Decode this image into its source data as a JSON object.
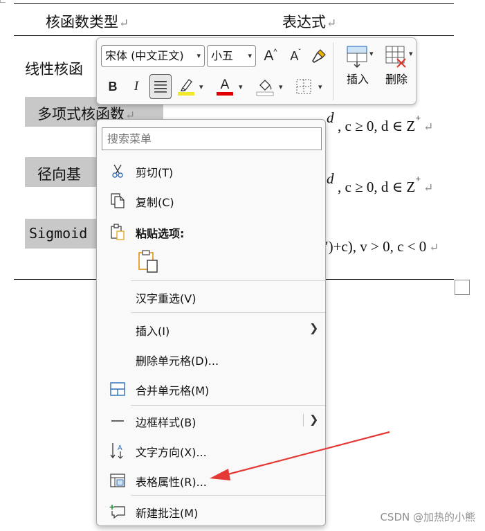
{
  "document": {
    "table": {
      "headers": [
        "核函数类型",
        "表达式"
      ],
      "row_labels": [
        "线性核函",
        "多项式核函数",
        "径向基",
        "Sigmoid"
      ],
      "formula_fragments": [
        {
          "pre": "d",
          "rest": ", c ≥ 0, d ∈ Z",
          "sup": "+"
        },
        {
          "pre": "d",
          "rest": ", c ≥ 0, d ∈ Z",
          "sup": "+"
        },
        {
          "pre": "′)+c",
          "rest": "), v > 0, c < 0",
          "sup": ""
        }
      ],
      "paragraph_mark": "↵"
    }
  },
  "mini_toolbar": {
    "font_family": "宋体 (中文正文)",
    "font_size": "小五",
    "grow_font": "A",
    "shrink_font": "A",
    "bold": "B",
    "italic": "I",
    "font_color_glyph": "A",
    "insert_label": "插入",
    "delete_label": "删除",
    "colors": {
      "highlight": "#f2e92a",
      "font_color": "#e00000"
    }
  },
  "context_menu": {
    "search_placeholder": "搜索菜单",
    "items": [
      {
        "label": "剪切(T)",
        "icon": "scissors-icon"
      },
      {
        "label": "复制(C)",
        "icon": "copy-icon"
      },
      {
        "label": "粘贴选项:",
        "icon": "paste-icon"
      },
      {
        "label": "汉字重选(V)",
        "icon": ""
      },
      {
        "label": "插入(I)",
        "icon": "",
        "submenu": true
      },
      {
        "label": "删除单元格(D)...",
        "icon": ""
      },
      {
        "label": "合并单元格(M)",
        "icon": "merge-cells-icon"
      },
      {
        "label": "边框样式(B)",
        "icon": "border-style-icon",
        "submenu": true
      },
      {
        "label": "文字方向(X)...",
        "icon": "text-direction-icon"
      },
      {
        "label": "表格属性(R)...",
        "icon": "table-properties-icon"
      },
      {
        "label": "新建批注(M)",
        "icon": "new-comment-icon"
      }
    ]
  },
  "watermark": "CSDN @加热的小熊",
  "annotation_color": "#e53935"
}
